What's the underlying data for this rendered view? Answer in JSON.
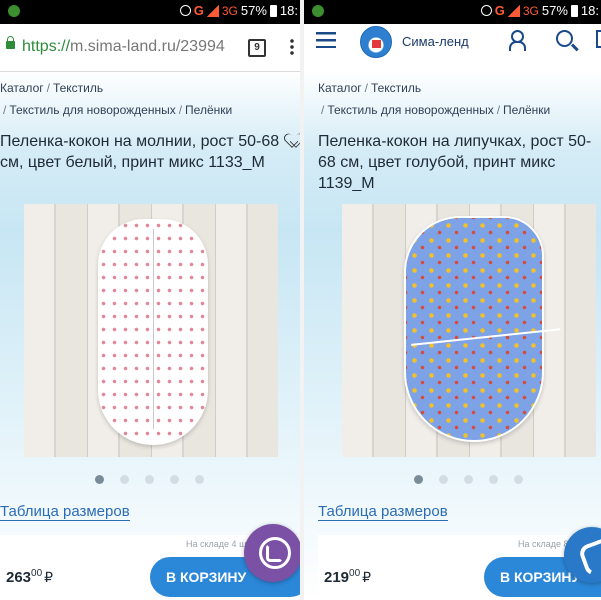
{
  "status_left": {
    "carrier_icon": "green-dot-icon",
    "text_g": "G",
    "net": "3G",
    "battery": "57%",
    "time": "18:"
  },
  "status_right": {
    "carrier_icon": "green-dot-icon",
    "text_g": "G",
    "net": "3G",
    "battery": "57%",
    "time": "18:"
  },
  "browser": {
    "url_scheme": "https://",
    "url_rest": "m.sima-land.ru/23994",
    "tab_count": "9"
  },
  "app": {
    "brand": "Сима-ленд"
  },
  "left": {
    "crumbs_1": [
      "Каталог",
      "Текстиль"
    ],
    "crumbs_2": [
      "Текстиль для новорожденных",
      "Пелёнки"
    ],
    "title": "Пеленка-кокон на молнии, рост 50-68 см, цвет белый, принт микс 1133_М",
    "size_table": "Таблица размеров",
    "stock": "На складе 4 шт",
    "price_int": "263",
    "price_cents": "00",
    "currency": "₽",
    "cart_button": "В КОРЗИНУ"
  },
  "right": {
    "crumbs_1": [
      "Каталог",
      "Текстиль"
    ],
    "crumbs_2": [
      "Текстиль для новорожденных",
      "Пелёнки"
    ],
    "title": "Пеленка-кокон на липучках, рост 50-68 см, цвет голубой, принт микс 1139_М",
    "size_table": "Таблица размеров",
    "stock": "На складе 8 шт",
    "price_int": "219",
    "price_cents": "00",
    "currency": "₽",
    "cart_button": "В КОРЗИНУ"
  },
  "colors": {
    "accent": "#2b87d8",
    "link": "#2b6cb5",
    "viber": "#7b51a5",
    "url_secure": "#2e8b3a"
  },
  "icons": {
    "left_fab": "viber-icon",
    "right_fab": "phone-icon",
    "favorite": "heart-icon"
  }
}
